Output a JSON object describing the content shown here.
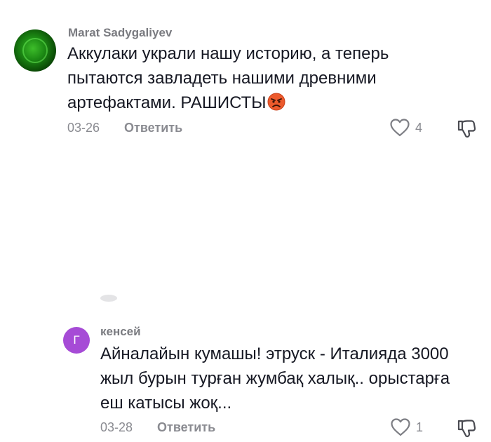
{
  "comments": [
    {
      "username": "Marat Sadygaliyev",
      "avatar_icon": "yin-yang-icon",
      "avatar_color": "#1c8a14",
      "text": "Аккулаки украли нашу историю, а теперь пытаются завладеть нашими древними артефактами. РАШИСТЫ",
      "emoji": "angry-face-icon",
      "date": "03-26",
      "reply_label": "Ответить",
      "likes": "4"
    },
    {
      "username": "кенсей",
      "avatar_letter": "Г",
      "avatar_color": "#a64bd6",
      "text": "Айналайын кумашы! этруск - Италияда 3000 жыл бурын турған жумбақ халық.. орыстарға еш катысы жоқ...",
      "date": "03-28",
      "reply_label": "Ответить",
      "likes": "1"
    }
  ],
  "colors": {
    "text": "#161823",
    "muted": "#8a8b91",
    "username": "#7a7b80"
  }
}
